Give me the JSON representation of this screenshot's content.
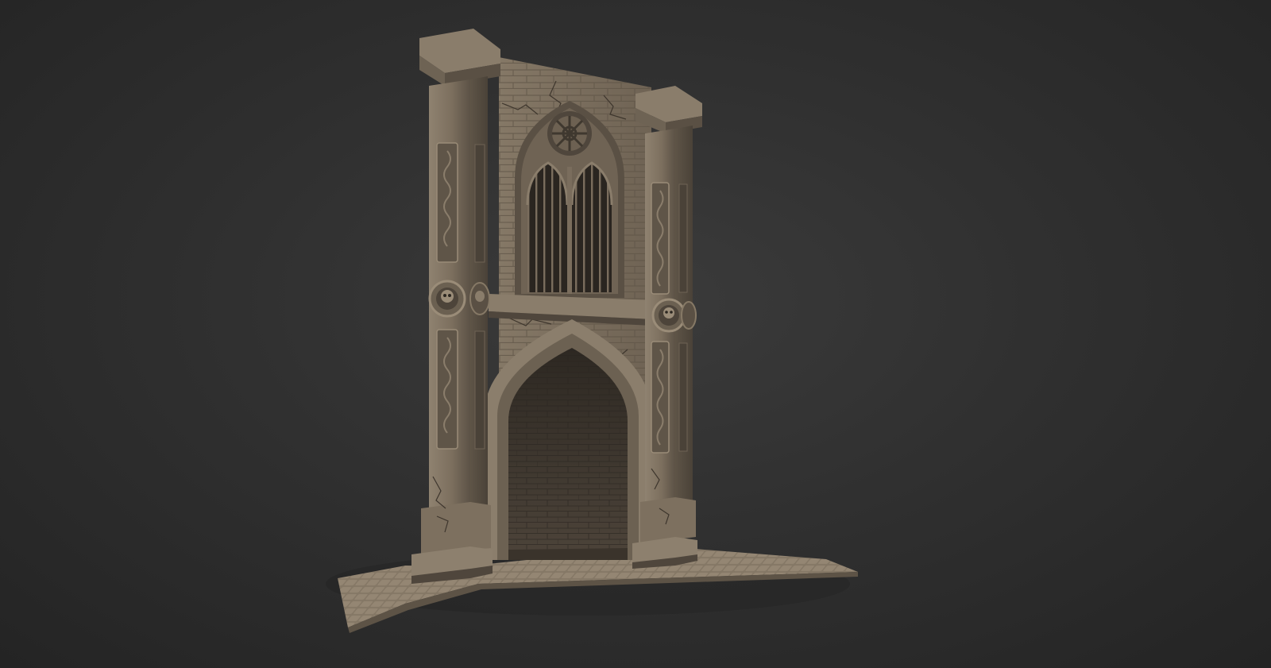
{
  "scene": {
    "description_visible_text": "",
    "colors": {
      "background_center": "#3b3b3b",
      "background_edge": "#242424",
      "stone_light": "#948673",
      "stone_mid": "#7a6d5d",
      "stone_dark": "#4f463c",
      "shadow": "#2b2620"
    }
  }
}
